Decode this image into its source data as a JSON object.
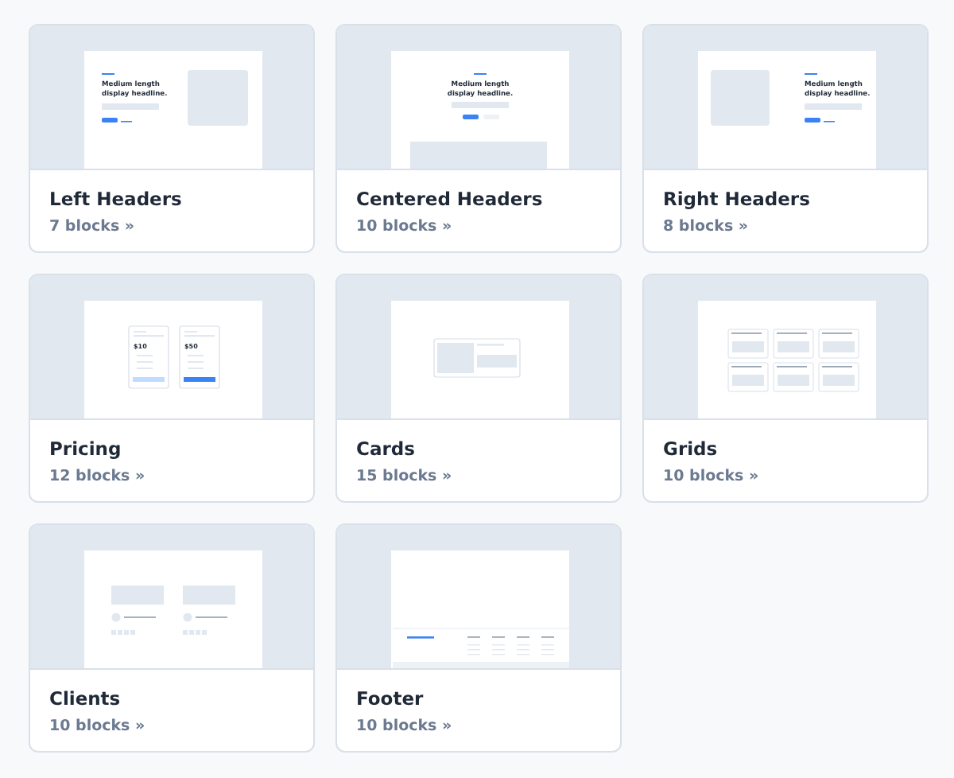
{
  "blocks": [
    {
      "title": "Left Headers",
      "count": "7 blocks »",
      "thumbnail": {
        "kind": "left-header",
        "headline": [
          "Medium length",
          "display headline."
        ]
      }
    },
    {
      "title": "Centered Headers",
      "count": "10 blocks »",
      "thumbnail": {
        "kind": "centered-header",
        "headline": [
          "Medium length",
          "display headline."
        ]
      }
    },
    {
      "title": "Right Headers",
      "count": "8 blocks »",
      "thumbnail": {
        "kind": "right-header",
        "headline": [
          "Medium length",
          "display headline."
        ]
      }
    },
    {
      "title": "Pricing",
      "count": "12 blocks »",
      "thumbnail": {
        "kind": "pricing",
        "prices": [
          "$10",
          "$50"
        ]
      }
    },
    {
      "title": "Cards",
      "count": "15 blocks »",
      "thumbnail": {
        "kind": "cards"
      }
    },
    {
      "title": "Grids",
      "count": "10 blocks »",
      "thumbnail": {
        "kind": "grids"
      }
    },
    {
      "title": "Clients",
      "count": "10 blocks »",
      "thumbnail": {
        "kind": "clients"
      }
    },
    {
      "title": "Footer",
      "count": "10 blocks »",
      "thumbnail": {
        "kind": "footer"
      }
    }
  ]
}
